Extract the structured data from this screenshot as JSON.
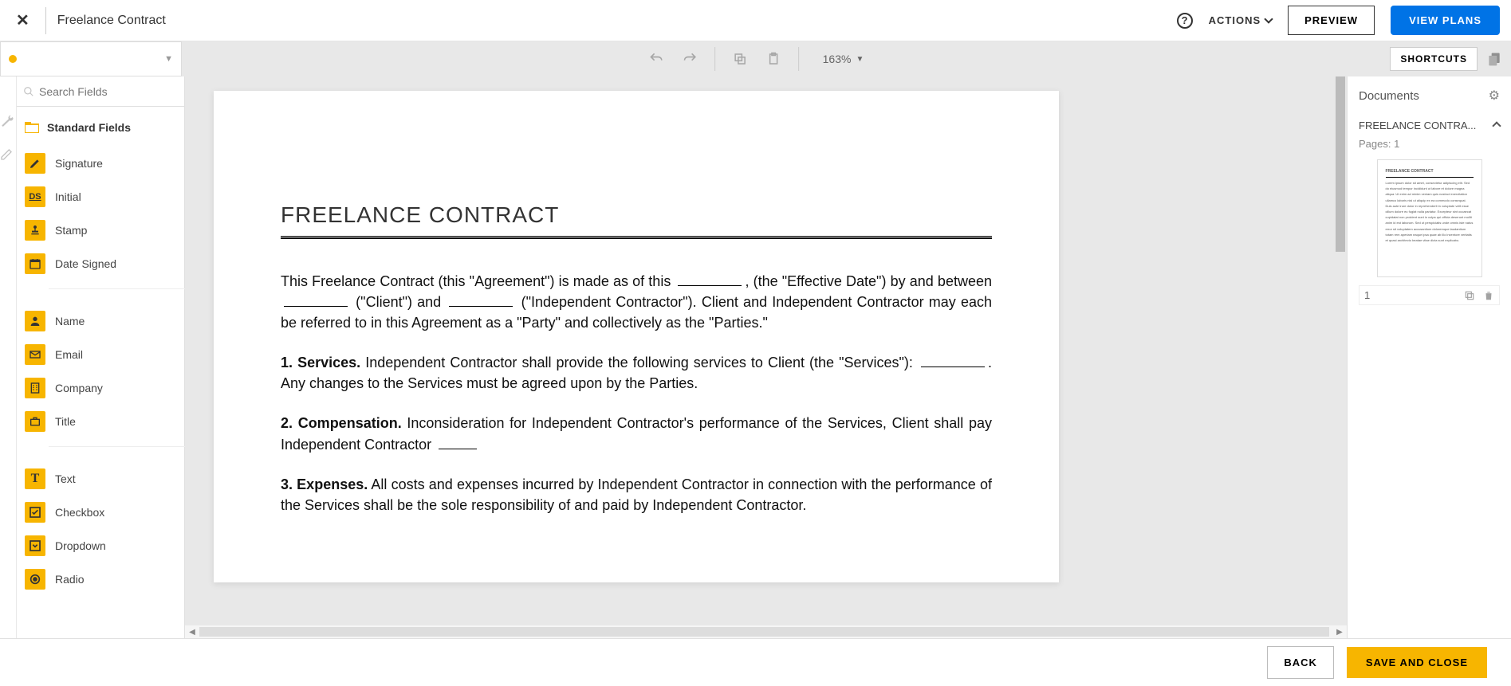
{
  "topbar": {
    "doc_title": "Freelance Contract",
    "actions_label": "ACTIONS",
    "preview_label": "PREVIEW",
    "view_plans_label": "VIEW PLANS"
  },
  "toolbar": {
    "zoom": "163%",
    "shortcuts_label": "SHORTCUTS"
  },
  "left": {
    "search_placeholder": "Search Fields",
    "standard_header": "Standard Fields",
    "fields_sig": "Signature",
    "fields_initial": "Initial",
    "fields_initial_icon": "DS",
    "fields_stamp": "Stamp",
    "fields_datesigned": "Date Signed",
    "fields_name": "Name",
    "fields_email": "Email",
    "fields_company": "Company",
    "fields_title": "Title",
    "fields_text": "Text",
    "fields_checkbox": "Checkbox",
    "fields_dropdown": "Dropdown",
    "fields_radio": "Radio"
  },
  "doc": {
    "title": "FREELANCE CONTRACT",
    "p1_a": "This Freelance Contract (this \"Agreement\") is made as of this ",
    "p1_b": ", (the \"Effective Date\") by and between ",
    "p1_c": " (\"Client\") and ",
    "p1_d": " (\"Independent Contractor\"). Client and Independent Contractor may each be referred to in this Agreement as a \"Party\" and collectively as the \"Parties.\"",
    "p2_n": "1. Services.",
    "p2_a": " Independent Contractor shall provide the following services to Client (the \"Services\"): ",
    "p2_b": ". Any changes to the Services must be agreed upon by the Parties.",
    "p3_n": "2. Compensation.",
    "p3_a": " Inconsideration for Independent Contractor's performance of the Services, Client shall pay Independent Contractor ",
    "p4_n": "3. Expenses.",
    "p4_a": " All costs and expenses incurred by Independent Contractor in connection with the performance of the Services shall be the sole responsibility of and paid by Independent Contractor."
  },
  "right": {
    "header": "Documents",
    "docname": "FREELANCE CONTRA...",
    "pages": "Pages: 1",
    "pagenum": "1"
  },
  "footer": {
    "back": "BACK",
    "save": "SAVE AND CLOSE"
  }
}
